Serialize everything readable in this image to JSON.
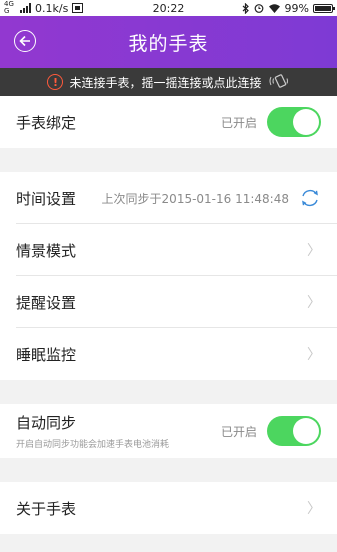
{
  "statusbar": {
    "network_type": "4G",
    "network_sub": "G",
    "speed": "0.1k/s",
    "time": "20:22",
    "battery": "99%"
  },
  "header": {
    "title": "我的手表"
  },
  "notice": {
    "text": "未连接手表，摇一摇连接或点此连接"
  },
  "settings": {
    "binding": {
      "label": "手表绑定",
      "status": "已开启"
    },
    "time": {
      "label": "时间设置",
      "last_sync": "上次同步于2015-01-16 11:48:48"
    },
    "scene": {
      "label": "情景模式"
    },
    "reminder": {
      "label": "提醒设置"
    },
    "sleep": {
      "label": "睡眠监控"
    },
    "auto_sync": {
      "label": "自动同步",
      "sub": "开启自动同步功能会加速手表电池消耗",
      "status": "已开启"
    },
    "about": {
      "label": "关于手表"
    }
  },
  "colors": {
    "header_gradient": [
      "#9238d0",
      "#7e3ad4"
    ],
    "toggle_on": "#4cd65f",
    "warning": "#ff5a3c",
    "sync_icon": "#3a8ad8"
  },
  "icons": {
    "back": "back-arrow-icon",
    "warning": "warning-icon",
    "shake": "shake-phone-icon",
    "sync": "sync-icon",
    "chevron": "chevron-right-icon"
  }
}
